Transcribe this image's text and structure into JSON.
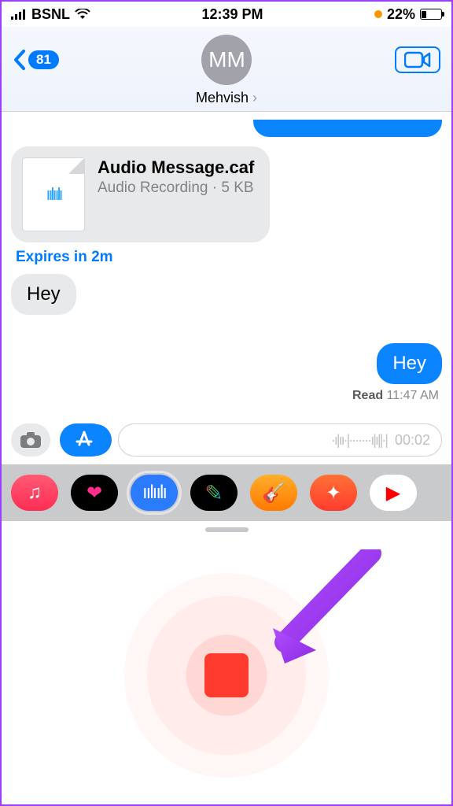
{
  "status": {
    "carrier": "BSNL",
    "time": "12:39 PM",
    "battery_pct": "22%"
  },
  "nav": {
    "back_count": "81",
    "avatar_initials": "MM",
    "contact_name": "Mehvish"
  },
  "messages": {
    "attachment": {
      "filename": "Audio Message.caf",
      "subtitle": "Audio Recording · 5 KB"
    },
    "expires_label": "Expires in 2m",
    "incoming_text": "Hey",
    "outgoing_text": "Hey",
    "read_label": "Read",
    "read_time": "11:47 AM"
  },
  "input": {
    "recording_timer": "00:02"
  },
  "icons": {
    "music": "♫",
    "heart": "❤",
    "wave": "≡",
    "paint": "✎",
    "garage": "🎸",
    "wand": "✦",
    "yt": "▶"
  }
}
